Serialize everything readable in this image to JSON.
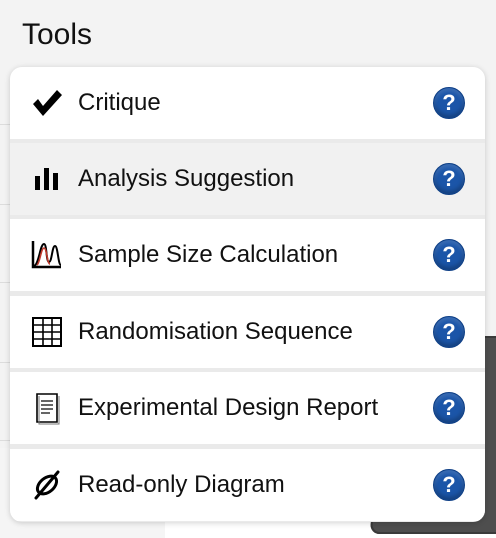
{
  "title": "Tools",
  "menu": {
    "items": [
      {
        "label": "Critique",
        "icon": "checkmark-icon"
      },
      {
        "label": "Analysis Suggestion",
        "icon": "bar-chart-icon"
      },
      {
        "label": "Sample Size Calculation",
        "icon": "distribution-curve-icon"
      },
      {
        "label": "Randomisation Sequence",
        "icon": "table-grid-icon"
      },
      {
        "label": "Experimental Design Report",
        "icon": "document-icon"
      },
      {
        "label": "Read-only Diagram",
        "icon": "crossed-link-icon"
      }
    ],
    "help_label": "?"
  },
  "colors": {
    "help_button": "#1b55a8",
    "hover_row": "#f1f1f1",
    "menu_background": "#ffffff"
  }
}
